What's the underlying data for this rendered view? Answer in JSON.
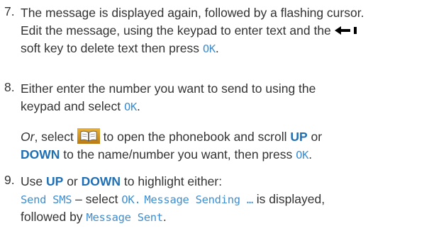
{
  "step7": {
    "number": "7.",
    "line1": "The message is displayed again, followed by a flashing cursor.",
    "line2_part1": "Edit the message, using the keypad to enter text and the",
    "line3_part1": "soft key to delete text then press",
    "ok": "OK",
    "end": "."
  },
  "step8": {
    "number": "8.",
    "line1": "Either enter the number you want to send to using the",
    "line2_part1": "keypad and select",
    "ok": "OK",
    "end": ".",
    "or": "Or",
    "or_select": ", select",
    "or_rest": "to open the phonebook and scroll",
    "up": "UP",
    "or_word": "or",
    "down": "DOWN",
    "line4_rest": "to the name/number you want, then press",
    "ok2": "OK",
    "end2": "."
  },
  "step9": {
    "number": "9.",
    "use": "Use",
    "up": "UP",
    "or_word": "or",
    "down": "DOWN",
    "rest": "to highlight either:",
    "send_sms": "Send SMS",
    "dash_select": "– select",
    "ok": "OK",
    "dot": ".",
    "message_sending": "Message Sending …",
    "is_displayed": "is displayed,",
    "followed_by": "followed by",
    "message_sent": "Message Sent",
    "end": "."
  },
  "icons": {
    "back_arrow": "left-arrow-delete-icon",
    "phonebook": "phonebook-icon"
  },
  "colors": {
    "text": "#333333",
    "lcd_blue": "#3f8ed0",
    "key_blue": "#1f6fb5"
  }
}
